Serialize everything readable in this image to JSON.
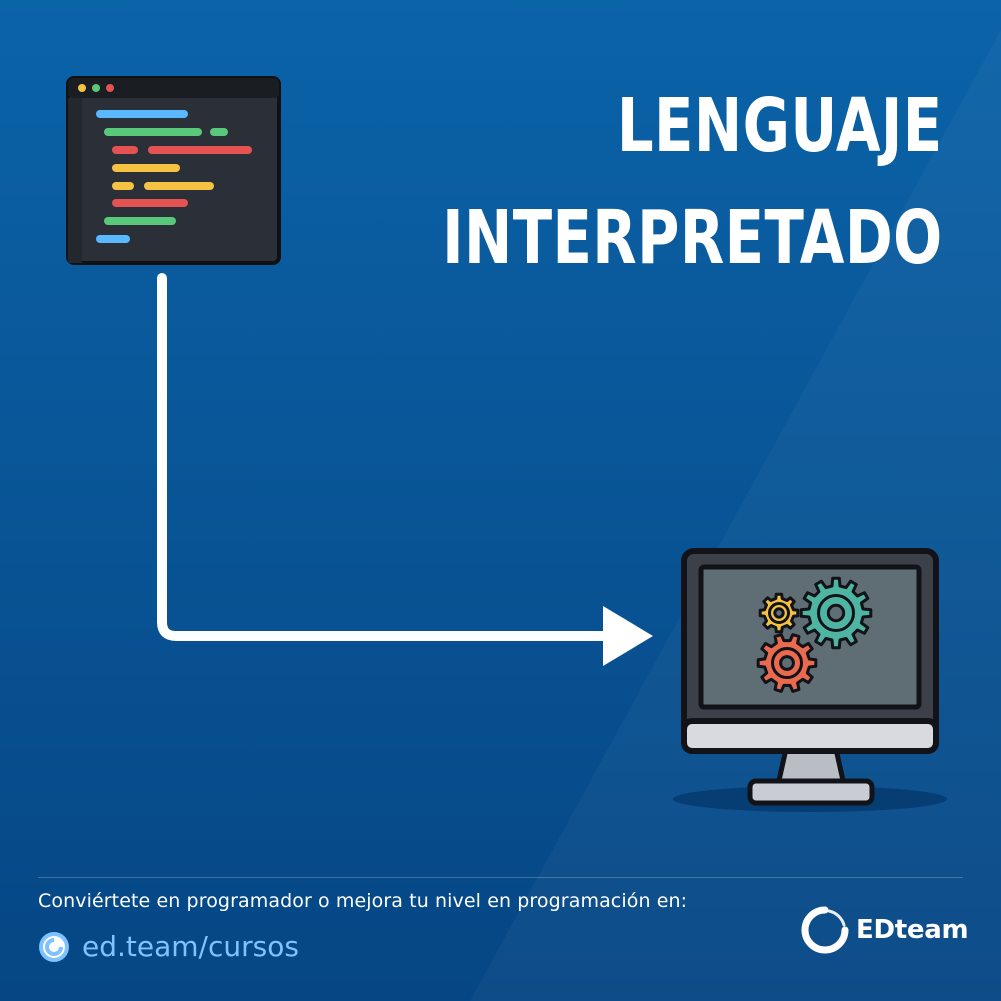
{
  "title": {
    "line1": "LENGUAJE",
    "line2": "INTERPRETADO"
  },
  "footer": {
    "cta_text": "Conviértete en programador o mejora tu nivel en programación en:",
    "link_text": "ed.team/cursos",
    "brand_name": "EDteam"
  },
  "colors": {
    "background": "#0a5796",
    "background_dark": "#064684",
    "link": "#7ec2ff",
    "code_blue": "#5ab8ff",
    "code_green": "#58c87a",
    "code_red": "#e55252",
    "code_yellow": "#f6c243",
    "gear_yellow": "#f6c243",
    "gear_teal": "#4fb5a3",
    "gear_red": "#e96a4f"
  },
  "icons": [
    "code-editor-icon",
    "flow-arrow",
    "computer-monitor-icon",
    "gear-icon",
    "edteam-logo-icon"
  ]
}
